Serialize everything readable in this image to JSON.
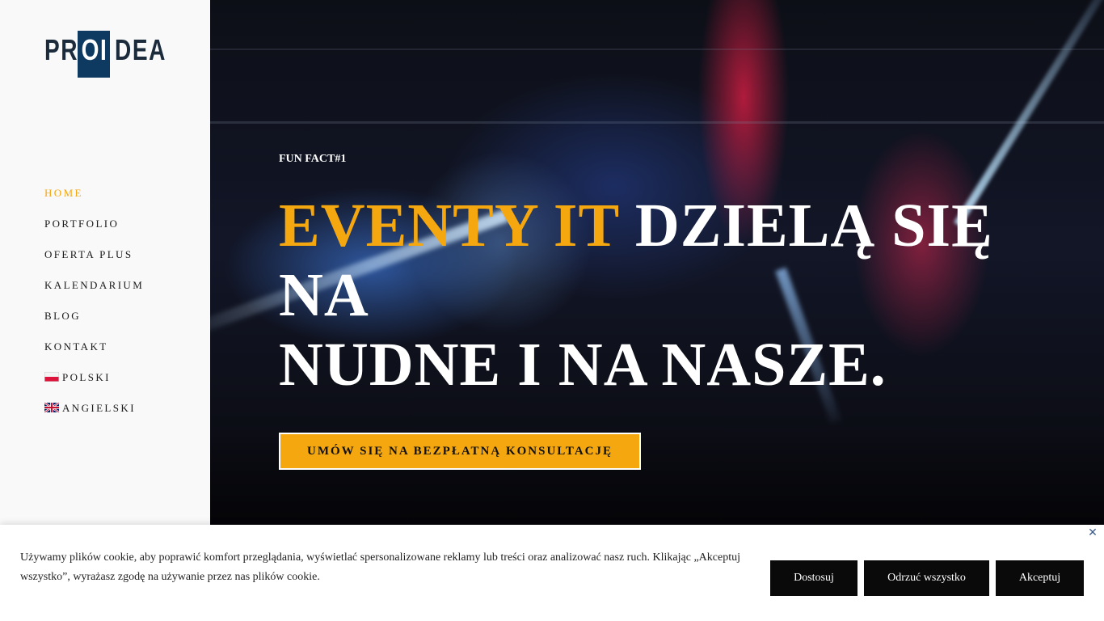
{
  "logo": {
    "left": "PR",
    "mid": "OI",
    "right": "DEA"
  },
  "nav": {
    "items": [
      {
        "label": "HOME",
        "active": true
      },
      {
        "label": "PORTFOLIO"
      },
      {
        "label": "OFERTA PLUS"
      },
      {
        "label": "KALENDARIUM"
      },
      {
        "label": "BLOG"
      },
      {
        "label": "KONTAKT"
      },
      {
        "label": "POLSKI",
        "icon": "poland-flag-icon"
      },
      {
        "label": "ANGIELSKI",
        "icon": "uk-flag-icon"
      }
    ]
  },
  "hero": {
    "eyebrow": "FUN FACT#1",
    "headline_accent": "EVENTY IT",
    "headline_line1_rest": "DZIELĄ SIĘ NA",
    "headline_line2": "NUDNE I NA NASZE.",
    "cta_label": "UMÓW SIĘ NA BEZPŁATNĄ KONSULTACJĘ"
  },
  "cookie": {
    "text": "Używamy plików cookie, aby poprawić komfort przeglądania, wyświetlać spersonalizowane reklamy lub treści oraz analizować nasz ruch. Klikając „Akceptuj wszystko”, wyrażasz zgodę na używanie przez nas plików cookie.",
    "close_icon": "close-icon",
    "customize_label": "Dostosuj",
    "reject_label": "Odrzuć wszystko",
    "accept_label": "Akceptuj"
  },
  "colors": {
    "accent": "#f5a70f",
    "logo_box": "#0e3a62",
    "sidebar_bg": "#f9f9f9",
    "button_dark": "#0a0a0a"
  }
}
